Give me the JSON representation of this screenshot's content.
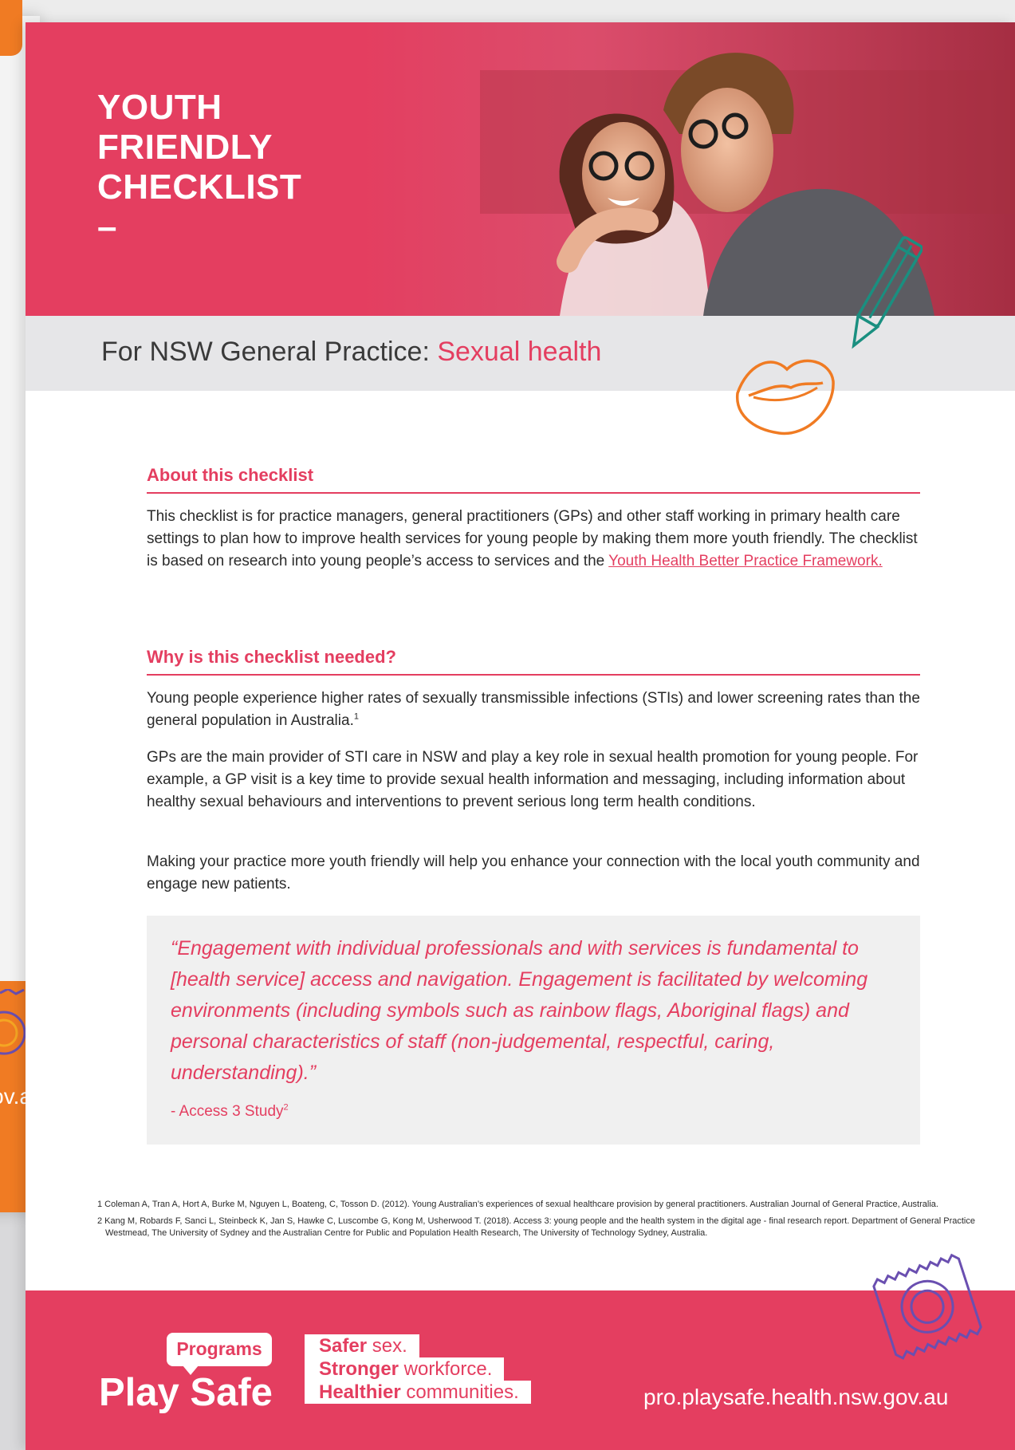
{
  "colors": {
    "brand_pink": "#e43e60",
    "accent_orange": "#f07b23",
    "accent_teal": "#1a8f80",
    "accent_purple": "#6a4fb0",
    "band_grey": "#e6e6e8"
  },
  "background": {
    "left_page_fragment_text": "ov.a"
  },
  "hero": {
    "title_lines": [
      "YOUTH",
      "FRIENDLY",
      "CHECKLIST",
      "–"
    ],
    "photo_icon": "couple-photo"
  },
  "subtitle": {
    "prefix": "For NSW General Practice: ",
    "accent": "Sexual health"
  },
  "sections": {
    "about": {
      "heading": "About this checklist",
      "text": "This checklist is for practice managers, general practitioners (GPs) and other staff working in primary health care settings to plan how to improve health services for young people by making them more youth friendly. The checklist is based on research into young people’s access to services and the ",
      "link": "Youth Health Better Practice Framework."
    },
    "why": {
      "heading": "Why is this checklist needed?",
      "p1": "Young people experience higher rates of sexually transmissible infections (STIs) and lower screening rates than the general population in Australia.",
      "p1_sup": "1",
      "p2": "GPs are the main provider of STI care in NSW and play a key role in sexual health promotion for young people. For example, a GP visit is a key time to provide sexual health information and messaging, including information about healthy sexual behaviours and interventions to prevent serious long term health conditions.",
      "p3": "Making your practice more youth friendly will help you enhance your connection with the local youth community and engage new patients."
    }
  },
  "quote": {
    "text": "“Engagement with individual professionals and with services is fundamental to [health service] access and navigation. Engagement is facilitated by welcoming environments (including symbols such as rainbow flags, Aboriginal flags) and personal characteristics of staff (non-judgemental, respectful, caring, understanding).”",
    "cite": "- Access 3 Study",
    "cite_sup": "2"
  },
  "footnotes": [
    "1 Coleman A, Tran A, Hort A, Burke M, Nguyen L, Boateng, C, Tosson D. (2012). Young Australian’s experiences of sexual healthcare provision by general practitioners. Australian Journal of General Practice, Australia.",
    "2 Kang M, Robards F, Sanci L, Steinbeck K, Jan S, Hawke C, Luscombe G, Kong M, Usherwood T. (2018). Access 3: young people and the health system in the digital age - final research report. Department of General Practice Westmead, The University of Sydney and the Australian Centre for Public and Population Health Research, The University of Technology Sydney, Australia."
  ],
  "footer": {
    "logo_tab": "Programs",
    "logo_main": "Play Safe",
    "tagline": [
      {
        "bold": "Safer",
        "light": " sex."
      },
      {
        "bold": "Stronger",
        "light": " workforce."
      },
      {
        "bold": "Healthier",
        "light": " communities."
      }
    ],
    "url": "pro.playsafe.health.nsw.gov.au"
  }
}
